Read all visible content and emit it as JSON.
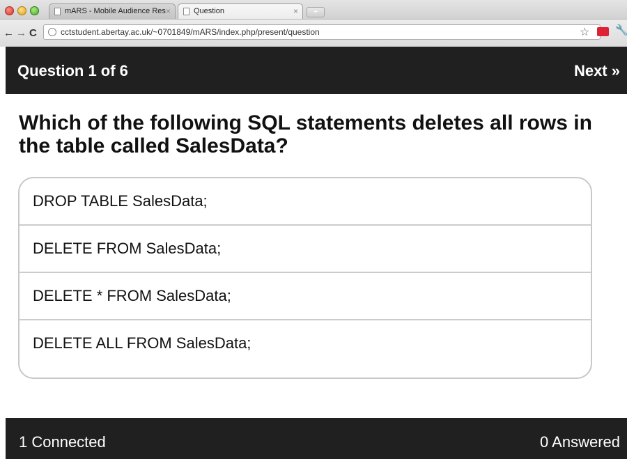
{
  "browser": {
    "tabs": [
      {
        "label": "mARS - Mobile Audience Res",
        "active": false
      },
      {
        "label": "Question",
        "active": true
      }
    ],
    "url": "cctstudent.abertay.ac.uk/~0701849/mARS/index.php/present/question"
  },
  "header": {
    "question_counter": "Question 1 of 6",
    "next_label": "Next »"
  },
  "question": {
    "text": "Which of the following SQL statements deletes all rows in the table called SalesData?"
  },
  "options": [
    {
      "label": "DROP TABLE SalesData;"
    },
    {
      "label": "DELETE FROM SalesData;"
    },
    {
      "label": "DELETE * FROM SalesData;"
    },
    {
      "label": "DELETE ALL FROM SalesData;"
    }
  ],
  "footer": {
    "connected": "1 Connected",
    "answered": "0 Answered"
  }
}
